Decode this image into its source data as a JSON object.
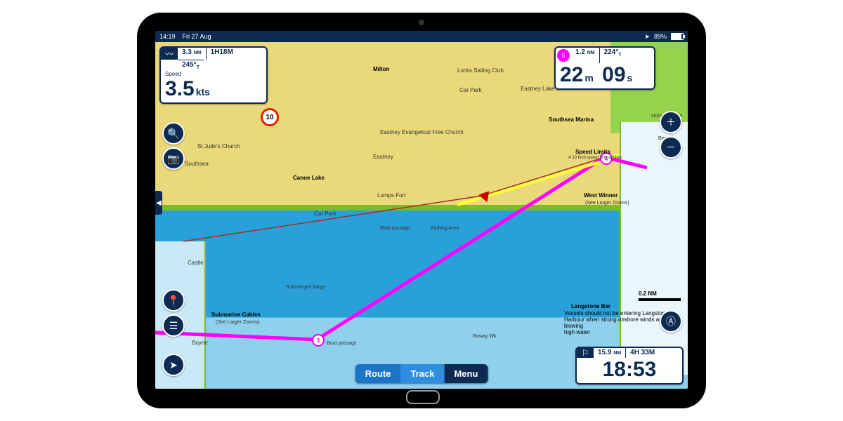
{
  "status": {
    "time": "14:19",
    "date": "Fri 27 Aug",
    "battery_pct": "89%"
  },
  "speed_panel": {
    "distance": "3.3",
    "distance_unit": "NM",
    "eta": "1H18M",
    "heading": "245°",
    "heading_suffix": "T",
    "label": "Speed",
    "value": "3.5",
    "unit": "kts"
  },
  "next_wp_panel": {
    "wp_id": "5",
    "distance": "1.2",
    "distance_unit": "NM",
    "bearing": "224°",
    "bearing_suffix": "T",
    "minutes": "22",
    "minutes_unit": "m",
    "seconds": "09",
    "seconds_unit": "s"
  },
  "route_total_panel": {
    "distance": "15.9",
    "distance_unit": "NM",
    "duration": "4H 33M",
    "clock": "18:53"
  },
  "scale": {
    "value": "0.2",
    "unit": "NM"
  },
  "speed_limit": "10",
  "bottom_tabs": {
    "route": "Route",
    "track": "Track",
    "menu": "Menu"
  },
  "map_labels": {
    "milton": "Milton",
    "locks": "Locks Sailing Club",
    "carpark1": "Car Park",
    "eastney_lake": "Eastney Lake",
    "eastney_church": "Eastney Evangelical Free Church",
    "eastney": "Eastney",
    "stjudes": "St Jude's Church",
    "southsea": "Southsea",
    "canoe": "Canoe Lake",
    "lumps": "Lumps Fort",
    "carpark2": "Car Park",
    "southsea_marina": "Southsea Marina",
    "speedlimits_title": "Speed Limits",
    "speedlimits_note": "A 10 knot speed limit applies",
    "boat_passage1": "Boat passage",
    "bathing": "Bathing Area",
    "westwinner": "West Winner",
    "seelarger1": "(See Larger Zooms)",
    "submarine": "Submarine Cables",
    "seelarger2": "(See Larger Zooms)",
    "boyne": "Boyne",
    "castle": "Castle",
    "submerged": "Submerged barge",
    "roway": "Roway Wk",
    "boat_passage2": "Boat passage",
    "langstone_bar": "Langstone Bar",
    "stone_harbour": "stone Harbour",
    "bee_ch": "Bee Ch"
  },
  "advisory": {
    "line1": "Vessels should not be entering Langstone",
    "line2": "Harbour when strong onshore winds are",
    "line3": "blowing",
    "line4": "high water"
  },
  "waypoints": {
    "wp3": "3",
    "wp4": "4",
    "wp5": "5"
  }
}
